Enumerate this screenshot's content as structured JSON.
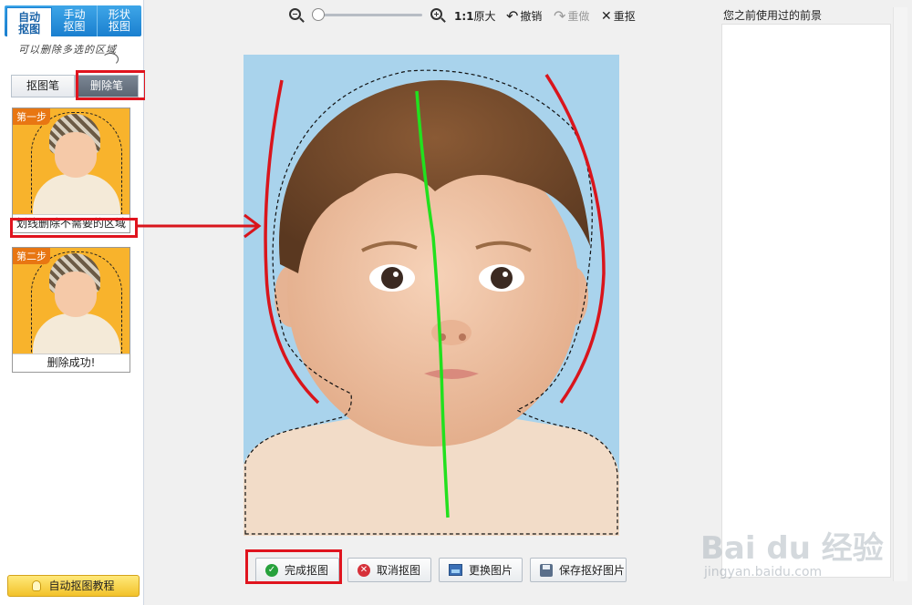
{
  "mode_tabs": [
    {
      "label": "自动\n抠图",
      "line1": "自动",
      "line2": "抠图",
      "active": true
    },
    {
      "label": "手动\n抠图",
      "line1": "手动",
      "line2": "抠图",
      "active": false
    },
    {
      "label": "形状\n抠图",
      "line1": "形状",
      "line2": "抠图",
      "active": false
    }
  ],
  "handwritten_note": "可以删除多选的区域",
  "pen_buttons": {
    "select_pen": "抠图笔",
    "delete_pen": "删除笔"
  },
  "steps": [
    {
      "tag": "第一步",
      "caption": "划线删除不需要的区域"
    },
    {
      "tag": "第二步",
      "caption": "删除成功!"
    }
  ],
  "tutorial_button": "自动抠图教程",
  "toolbar": {
    "zoom_out_icon": "zoom-out-icon",
    "zoom_in_icon": "zoom-in-icon",
    "ratio_label": "1:1",
    "original_size": "原大",
    "undo": "撤销",
    "redo": "重做",
    "reset": "重抠"
  },
  "bottom_buttons": {
    "finish": "完成抠图",
    "cancel": "取消抠图",
    "change": "更换图片",
    "save": "保存抠好图片"
  },
  "right_panel": {
    "title": "您之前使用过的前景"
  },
  "watermark": {
    "main": "Bai du 经验",
    "sub": "jingyan.baidu.com"
  },
  "colors": {
    "accent_blue": "#1a7fcf",
    "annotation_red": "#e0141e",
    "stroke_green": "#22e01e",
    "photo_bg": "#a9d3ec"
  }
}
